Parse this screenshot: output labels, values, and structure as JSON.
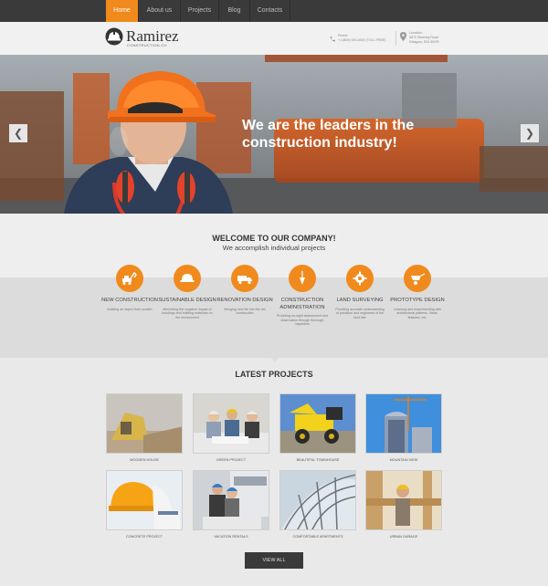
{
  "nav": {
    "items": [
      "Home",
      "About us",
      "Projects",
      "Blog",
      "Contacts"
    ],
    "active_index": 0
  },
  "header": {
    "logo_name": "Ramirez",
    "logo_sub": "CONSTRUCTION CO",
    "phone_label": "Phone:",
    "phone_value": "+1 (800) 000-0000 (TOLL FREE)",
    "location_label": "Location:",
    "location_line1": "9870 Steering Road",
    "location_line2": "Glasgow, D04 89GR"
  },
  "hero": {
    "headline": "We are the leaders in the construction industry!",
    "prev_icon": "chevron-left-icon",
    "next_icon": "chevron-right-icon"
  },
  "welcome": {
    "title": "WELCOME TO OUR COMPANY!",
    "subtitle": "We accomplish individual projects",
    "services": [
      {
        "name": "NEW CONSTRUCTION",
        "desc": "Building an object from scratch",
        "icon": "excavator-icon"
      },
      {
        "name": "SUSTAINABLE DESIGN",
        "desc": "Minimizing the negative impact of buildings and building materials on the environment",
        "icon": "hard-hat-icon"
      },
      {
        "name": "RENOVATION DESIGN",
        "desc": "Bringing new life into the old construction",
        "icon": "truck-icon"
      },
      {
        "name": "CONSTRUCTION ADMINISTRATION",
        "desc": "Providing on-sight assessment and observation through thorough inspection",
        "icon": "plumb-bob-icon"
      },
      {
        "name": "LAND SURVEYING",
        "desc": "Providing accurate understanding of positions and engineers of the land title",
        "icon": "gear-icon"
      },
      {
        "name": "PROTOTYPE DESIGN",
        "desc": "Learning and experimenting with architectural patterns, ideas, features, etc.",
        "icon": "wheelbarrow-icon"
      }
    ]
  },
  "projects": {
    "title": "LATEST PROJECTS",
    "items": [
      "WOODEN HOUSE",
      "GREEN PROJECT",
      "BEAUTIFUL TOWNHOUSE",
      "MOUNTAIN VIEW",
      "CONCRETE PROJECT",
      "VACATION RENTALS",
      "COMFORTABLE APARTMENTS",
      "URBAN GARAGE"
    ],
    "view_all_label": "VIEW ALL"
  },
  "colors": {
    "accent": "#f08a1c",
    "nav_bg": "#3a3a3a"
  }
}
